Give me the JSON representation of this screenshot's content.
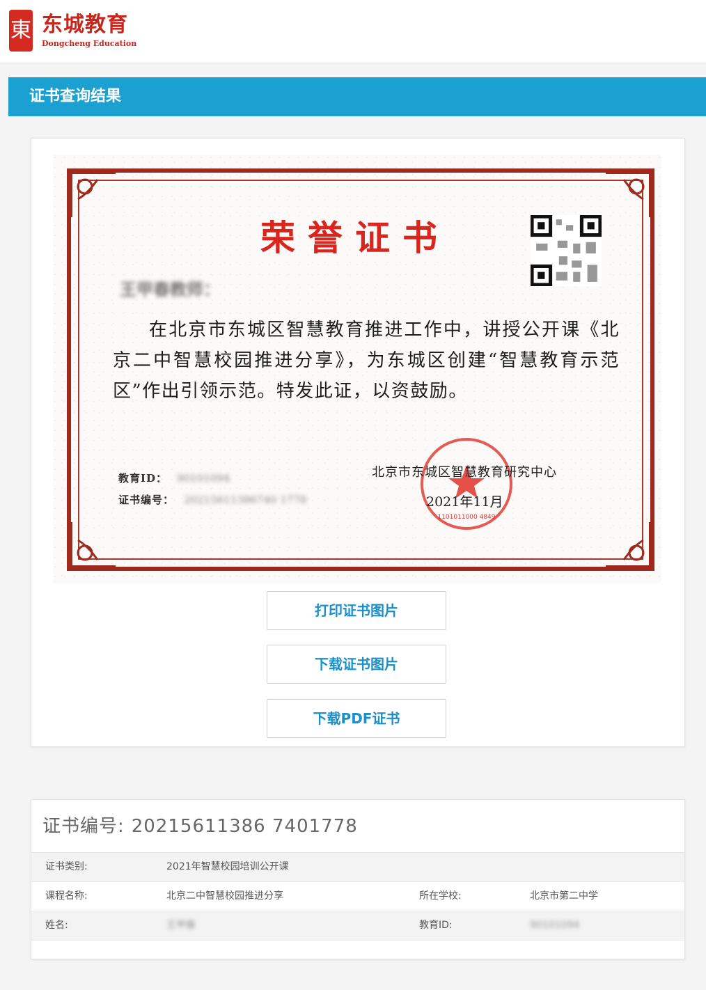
{
  "header": {
    "logo_char": "東",
    "logo_cn": "东城教育",
    "logo_en": "Dongcheng Education"
  },
  "title_bar": {
    "title": "证书查询结果"
  },
  "certificate": {
    "title": "荣誉证书",
    "recipient": "王甲春教师：",
    "body": "在北京市东城区智慧教育推进工作中，讲授公开课《北京二中智慧校园推进分享》，为东城区创建“智慧教育示范区”作出引领示范。特发此证，以资鼓励。",
    "edu_id_label": "教育ID：",
    "edu_id_value": "90101094",
    "cert_no_label": "证书编号：",
    "cert_no_value": "20215611386740 1778",
    "issuer": "北京市东城区智慧教育研究中心",
    "date": "2021年11月",
    "seal_code": "1101011000 4849",
    "colors": {
      "border": "#9e2a1e",
      "title": "#d8261e",
      "seal": "#e0322a"
    }
  },
  "buttons": {
    "print": "打印证书图片",
    "download_image": "下载证书图片",
    "download_pdf": "下载PDF证书"
  },
  "info": {
    "title_label": "证书编号:",
    "title_number": "20215611386 7401778",
    "rows": [
      {
        "label1": "证书类别:",
        "value1": "2021年智慧校园培训公开课",
        "label2": "",
        "value2": ""
      },
      {
        "label1": "课程名称:",
        "value1": "北京二中智慧校园推进分享",
        "label2": "所在学校:",
        "value2": "北京市第二中学"
      },
      {
        "label1": "姓名:",
        "value1": "王甲春",
        "label2": "教育ID:",
        "value2": "90101094"
      }
    ]
  },
  "theme": {
    "accent": "#1aa1d2",
    "button_text": "#1b8fc9",
    "brand_red": "#c8251c"
  }
}
